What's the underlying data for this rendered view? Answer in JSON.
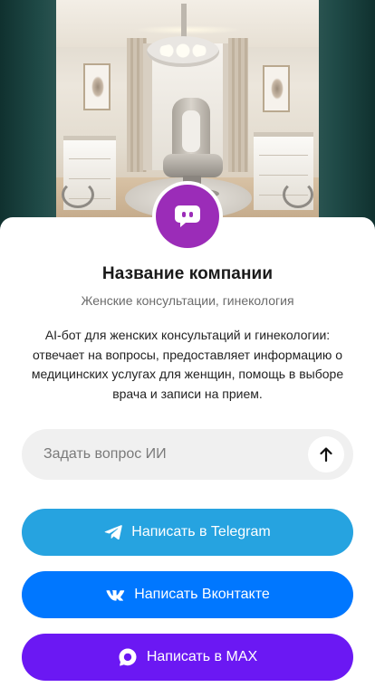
{
  "company": {
    "name": "Название компании",
    "category": "Женские консультации, гинекология",
    "description": "AI-бот для женских консультаций и гинекологии: отвечает на вопросы, предоставляет информацию о медицинских услугах для женщин, помощь в выборе врача и записи на прием.",
    "avatar_icon": "chat-bot-icon",
    "avatar_color": "#9b2cb8",
    "cover_image": "clinic-room-photo"
  },
  "ask": {
    "placeholder": "Задать вопрос ИИ",
    "send_icon": "arrow-up-icon"
  },
  "buttons": [
    {
      "label": "Написать в Telegram",
      "icon": "telegram-icon",
      "color": "#26a3e0"
    },
    {
      "label": "Написать Вконтакте",
      "icon": "vk-icon",
      "color": "#0077ff"
    },
    {
      "label": "Написать в MAX",
      "icon": "max-icon",
      "color": "#6b18f3"
    }
  ]
}
